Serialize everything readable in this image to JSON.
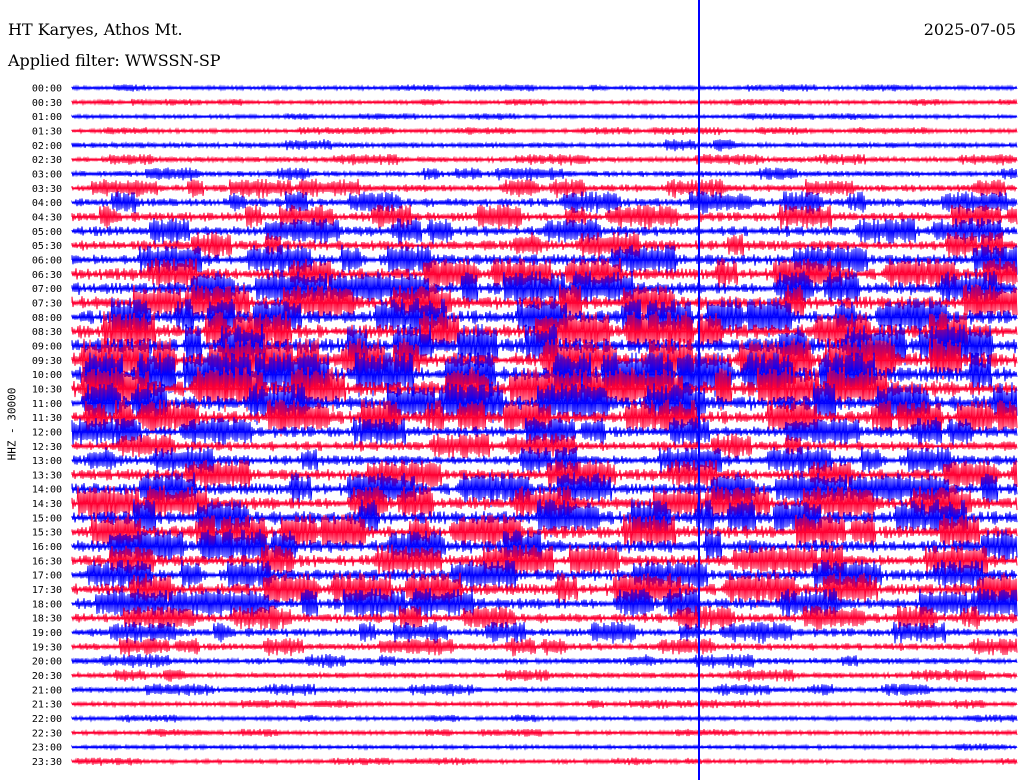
{
  "header": {
    "station": "HT Karyes, Athos Mt.",
    "filter": "Applied filter: WWSSN-SP",
    "date": "2025-07-05"
  },
  "chart_data": {
    "type": "line",
    "title": "HT Karyes, Athos Mt.",
    "subtitle": "Applied filter: WWSSN-SP",
    "date": "2025-07-05",
    "ylabel": "HHZ - 30000",
    "xlabel": "",
    "row_labels": [
      "00:00",
      "00:30",
      "01:00",
      "01:30",
      "02:00",
      "02:30",
      "03:00",
      "03:30",
      "04:00",
      "04:30",
      "05:00",
      "05:30",
      "06:00",
      "06:30",
      "07:00",
      "07:30",
      "08:00",
      "08:30",
      "09:00",
      "09:30",
      "10:00",
      "10:30",
      "11:00",
      "11:30",
      "12:00",
      "12:30",
      "13:00",
      "13:30",
      "14:00",
      "14:30",
      "15:00",
      "15:30",
      "16:00",
      "16:30",
      "17:00",
      "17:30",
      "18:00",
      "18:30",
      "19:00",
      "19:30",
      "20:00",
      "20:30",
      "21:00",
      "21:30",
      "22:00",
      "22:30",
      "23:00",
      "23:30"
    ],
    "series_colors": [
      "#0000ff",
      "#ff0033"
    ],
    "relative_activity": [
      0.05,
      0.04,
      0.04,
      0.06,
      0.14,
      0.12,
      0.16,
      0.26,
      0.32,
      0.36,
      0.4,
      0.42,
      0.46,
      0.5,
      0.55,
      0.58,
      0.6,
      0.64,
      0.7,
      0.72,
      0.75,
      0.72,
      0.66,
      0.56,
      0.44,
      0.38,
      0.42,
      0.46,
      0.52,
      0.56,
      0.58,
      0.56,
      0.54,
      0.5,
      0.46,
      0.52,
      0.48,
      0.36,
      0.3,
      0.24,
      0.18,
      0.14,
      0.14,
      0.08,
      0.06,
      0.06,
      0.05,
      0.06
    ],
    "grid": false,
    "legend": "none"
  }
}
